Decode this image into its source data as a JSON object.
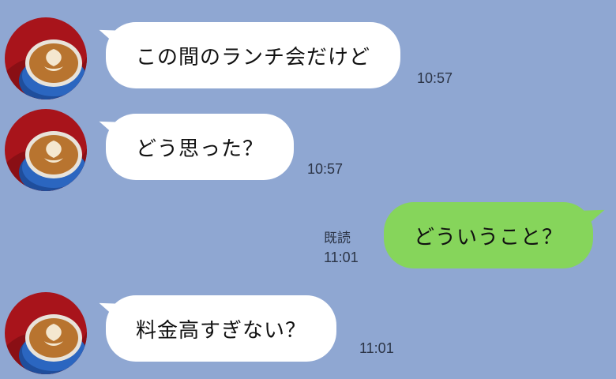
{
  "colors": {
    "background": "#8fa7d2",
    "received_bubble": "#ffffff",
    "sent_bubble": "#86d55b",
    "meta_text": "#2c3547"
  },
  "messages": [
    {
      "side": "received",
      "avatar_icon": "latte-art-avatar-icon",
      "text": "この間のランチ会だけど",
      "time": "10:57"
    },
    {
      "side": "received",
      "avatar_icon": "latte-art-avatar-icon",
      "text": "どう思った？",
      "time": "10:57"
    },
    {
      "side": "sent",
      "text": "どういうこと？",
      "read_label": "既読",
      "time": "11:01"
    },
    {
      "side": "received",
      "avatar_icon": "latte-art-avatar-icon",
      "text": "料金高すぎない？",
      "time": "11:01"
    }
  ]
}
